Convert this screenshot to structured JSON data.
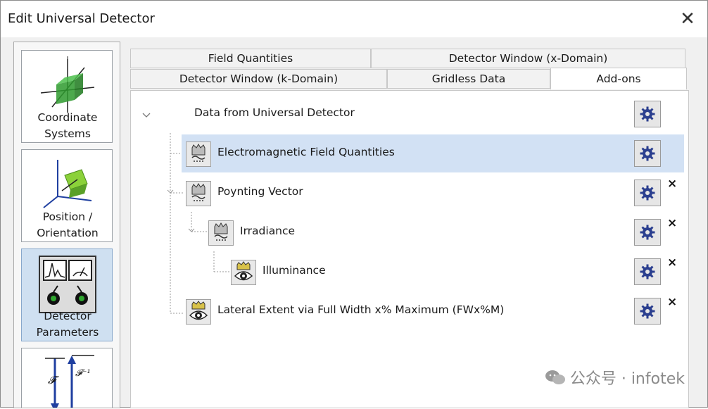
{
  "window": {
    "title": "Edit Universal Detector",
    "close_symbol": "✕"
  },
  "sidebar": {
    "items": [
      {
        "label_line1": "Coordinate",
        "label_line2": "Systems",
        "icon": "coordinate-systems-icon"
      },
      {
        "label_line1": "Position /",
        "label_line2": "Orientation",
        "icon": "position-orientation-icon"
      },
      {
        "label_line1": "Detector",
        "label_line2": "Parameters",
        "icon": "detector-parameters-icon",
        "active": true
      },
      {
        "label_line1": "",
        "label_line2": "",
        "icon": "fourier-transform-icon",
        "glyph1": "𝓕",
        "glyph2": "𝓕⁻¹"
      }
    ]
  },
  "tabs": {
    "row1": [
      "Field Quantities",
      "Detector Window (x-Domain)"
    ],
    "row2": [
      "Detector Window (k-Domain)",
      "Gridless Data",
      "Add-ons"
    ],
    "active": "Add-ons"
  },
  "tree": {
    "root": {
      "label": "Data from Universal Detector",
      "expander": "⌄"
    },
    "nodes": [
      {
        "label": "Electromagnetic Field Quantities",
        "icon": "field-quantities-icon",
        "removable": false,
        "selected": true
      },
      {
        "label": "Poynting Vector",
        "icon": "poynting-vector-icon",
        "removable": true
      },
      {
        "label": "Irradiance",
        "icon": "irradiance-icon",
        "removable": true
      },
      {
        "label": "Illuminance",
        "icon": "illuminance-eye-icon",
        "removable": true
      },
      {
        "label": "Lateral Extent via Full Width x% Maximum (FWx%M)",
        "icon": "lateral-extent-eye-icon",
        "removable": true
      }
    ],
    "remove_symbol": "×"
  },
  "watermark": {
    "text": "公众号 · infotek"
  },
  "colors": {
    "selection": "#d2e1f4",
    "active_side": "#cfe0f1",
    "gear": "#2b3f8f"
  }
}
